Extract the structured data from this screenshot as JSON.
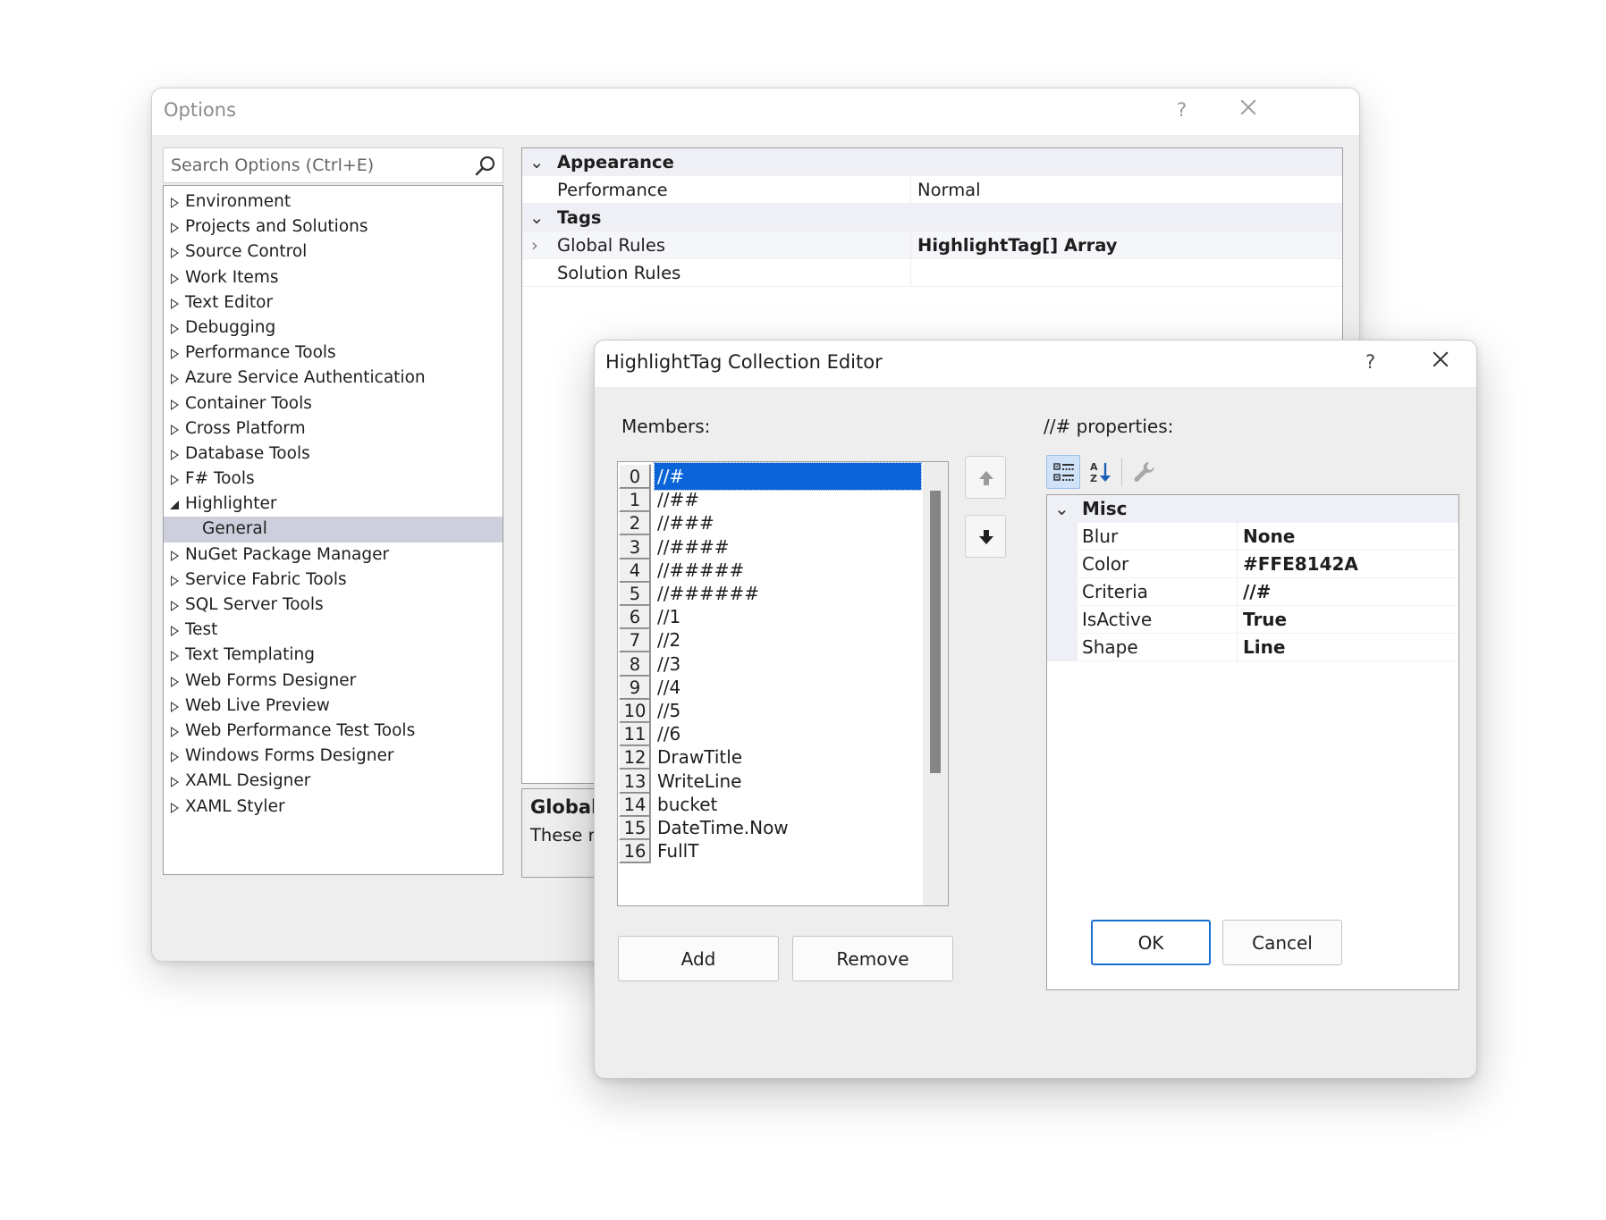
{
  "options": {
    "title": "Options",
    "help": "?",
    "search_placeholder": "Search Options (Ctrl+E)",
    "tree": [
      {
        "label": "Environment",
        "state": "collapsed"
      },
      {
        "label": "Projects and Solutions",
        "state": "collapsed"
      },
      {
        "label": "Source Control",
        "state": "collapsed"
      },
      {
        "label": "Work Items",
        "state": "collapsed"
      },
      {
        "label": "Text Editor",
        "state": "collapsed"
      },
      {
        "label": "Debugging",
        "state": "collapsed"
      },
      {
        "label": "Performance Tools",
        "state": "collapsed"
      },
      {
        "label": "Azure Service Authentication",
        "state": "collapsed"
      },
      {
        "label": "Container Tools",
        "state": "collapsed"
      },
      {
        "label": "Cross Platform",
        "state": "collapsed"
      },
      {
        "label": "Database Tools",
        "state": "collapsed"
      },
      {
        "label": "F# Tools",
        "state": "collapsed"
      },
      {
        "label": "Highlighter",
        "state": "expanded"
      },
      {
        "label": "General",
        "state": "child-selected"
      },
      {
        "label": "NuGet Package Manager",
        "state": "collapsed"
      },
      {
        "label": "Service Fabric Tools",
        "state": "collapsed"
      },
      {
        "label": "SQL Server Tools",
        "state": "collapsed"
      },
      {
        "label": "Test",
        "state": "collapsed"
      },
      {
        "label": "Text Templating",
        "state": "collapsed"
      },
      {
        "label": "Web Forms Designer",
        "state": "collapsed"
      },
      {
        "label": "Web Live Preview",
        "state": "collapsed"
      },
      {
        "label": "Web Performance Test Tools",
        "state": "collapsed"
      },
      {
        "label": "Windows Forms Designer",
        "state": "collapsed"
      },
      {
        "label": "XAML Designer",
        "state": "collapsed"
      },
      {
        "label": "XAML Styler",
        "state": "collapsed"
      }
    ],
    "grid": {
      "appearance": "Appearance",
      "performance_label": "Performance",
      "performance_value": "Normal",
      "tags": "Tags",
      "global_rules_label": "Global Rules",
      "global_rules_value": "HighlightTag[] Array",
      "solution_rules_label": "Solution Rules",
      "solution_rules_value": ""
    },
    "description": {
      "title": "Global",
      "text": "These ru"
    }
  },
  "editor": {
    "title": "HighlightTag Collection Editor",
    "help": "?",
    "members_label": "Members:",
    "properties_label": "//# properties:",
    "members": [
      {
        "index": "0",
        "text": "//#"
      },
      {
        "index": "1",
        "text": "//##"
      },
      {
        "index": "2",
        "text": "//###"
      },
      {
        "index": "3",
        "text": "//####"
      },
      {
        "index": "4",
        "text": "//#####"
      },
      {
        "index": "5",
        "text": "//######"
      },
      {
        "index": "6",
        "text": "//1"
      },
      {
        "index": "7",
        "text": "//2"
      },
      {
        "index": "8",
        "text": "//3"
      },
      {
        "index": "9",
        "text": "//4"
      },
      {
        "index": "10",
        "text": "//5"
      },
      {
        "index": "11",
        "text": "//6"
      },
      {
        "index": "12",
        "text": "DrawTitle"
      },
      {
        "index": "13",
        "text": "WriteLine"
      },
      {
        "index": "14",
        "text": "bucket"
      },
      {
        "index": "15",
        "text": "DateTime.Now"
      },
      {
        "index": "16",
        "text": "FullT"
      }
    ],
    "add_label": "Add",
    "remove_label": "Remove",
    "ok_label": "OK",
    "cancel_label": "Cancel",
    "category": "Misc",
    "properties": [
      {
        "name": "Blur",
        "value": "None"
      },
      {
        "name": "Color",
        "value": "#FFE8142A"
      },
      {
        "name": "Criteria",
        "value": "//#"
      },
      {
        "name": "IsActive",
        "value": "True"
      },
      {
        "name": "Shape",
        "value": "Line"
      }
    ]
  },
  "colors": {
    "selection": "#0a64d8",
    "tree_selection": "#cdd0dc",
    "default_button_border": "#1a6fcf"
  }
}
